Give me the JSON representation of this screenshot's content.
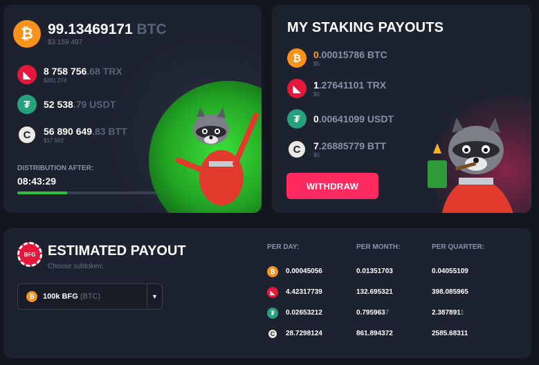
{
  "pool": {
    "total_amount": "99.13469171",
    "total_unit": "BTC",
    "total_usd": "$3 159 497",
    "rows": [
      {
        "coin": "trx",
        "icon": "tron-icon",
        "bright": "8 758 756",
        "dim": ".68 TRX",
        "usd": "$261 274"
      },
      {
        "coin": "usdt",
        "icon": "tether-icon",
        "bright": "52 538",
        "dim": ".79 USDT",
        "usd": ""
      },
      {
        "coin": "btt",
        "icon": "bittorrent-icon",
        "bright": "56 890 649",
        "dim": ".83 BTT",
        "usd": "$17 562"
      }
    ],
    "distribution_label": "DISTRIBUTION AFTER:",
    "distribution_time": "08:43:29",
    "distribution_progress": 0.36
  },
  "payouts": {
    "title": "MY STAKING PAYOUTS",
    "rows": [
      {
        "coin": "btc",
        "lead": "0",
        "rest": ".00015786",
        "unit": "BTC",
        "usd": "$5"
      },
      {
        "coin": "trx",
        "lead": "1",
        "rest": ".27641101",
        "unit": "TRX",
        "usd": "$0"
      },
      {
        "coin": "usdt",
        "lead": "0",
        "rest": ".00641099",
        "unit": "USDT",
        "usd": ""
      },
      {
        "coin": "btt",
        "lead": "7",
        "rest": ".26885779",
        "unit": "BTT",
        "usd": "$0"
      }
    ],
    "withdraw_label": "WITHDRAW"
  },
  "estimate": {
    "title": "ESTIMATED PAYOUT",
    "subtitle": "Choose subtoken:",
    "badge_text": "BFG",
    "select": {
      "value": "100k BFG",
      "unit": "(BTC)"
    },
    "headers": {
      "day": "PER DAY:",
      "month": "PER MONTH:",
      "quarter": "PER QUARTER:"
    },
    "rows": [
      {
        "coin": "btc",
        "day": "0.00045056",
        "month": "0.01351703",
        "quarter": "0.04055109"
      },
      {
        "coin": "trx",
        "day": "4.42317739",
        "month": "132.695321",
        "quarter": "398.085965"
      },
      {
        "coin": "usdt",
        "day": "0.02653212",
        "month": "0.795963",
        "month_dim": "7",
        "quarter": "2.387891",
        "quarter_dim": "1"
      },
      {
        "coin": "btt",
        "day": "28.7298124",
        "month": "861.894372",
        "quarter": "2585.68311"
      }
    ]
  },
  "colors": {
    "accent": "#ff2a5f",
    "btc": "#f7931a",
    "trx": "#e5173b",
    "usdt": "#26a17b",
    "progress": "#2fbf3a"
  }
}
